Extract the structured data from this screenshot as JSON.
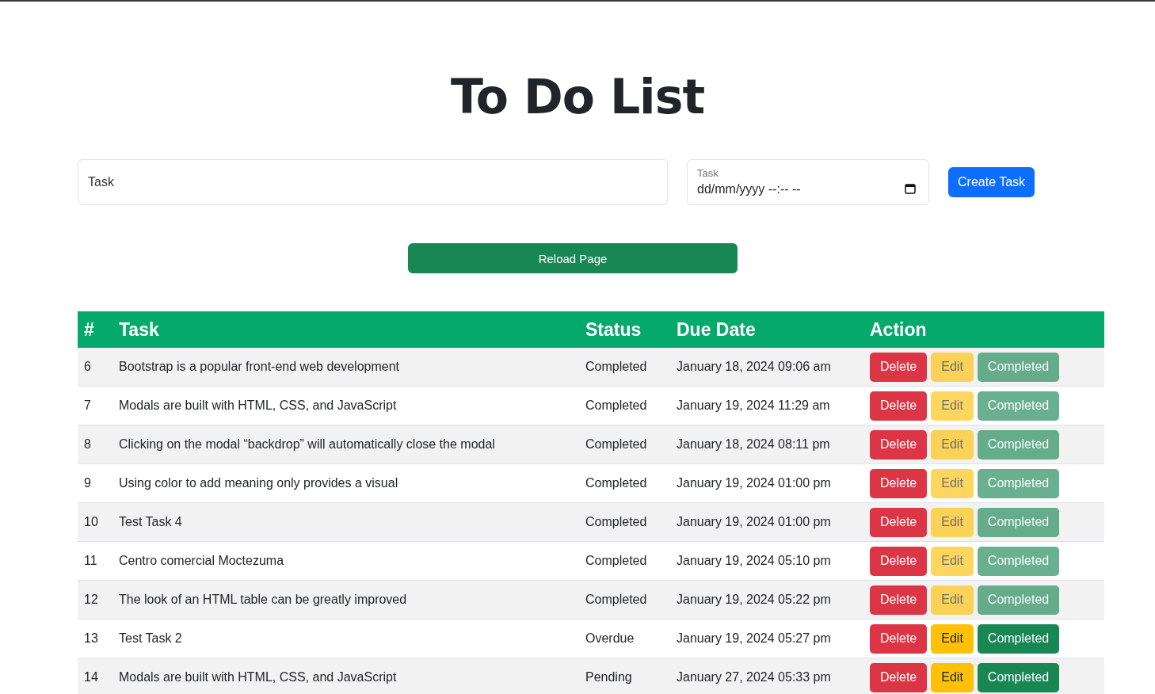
{
  "title": "To Do List",
  "form": {
    "task_field": {
      "placeholder": "Task"
    },
    "date_field": {
      "label": "Task",
      "value": "dd/mm/yyyy --:-- --"
    },
    "create_button": "Create Task"
  },
  "reload_button": "Reload Page",
  "table": {
    "columns": [
      "#",
      "Task",
      "Status",
      "Due Date",
      "Action"
    ],
    "rows": [
      {
        "id": "6",
        "task": "Bootstrap is a popular front-end web development",
        "status": "Completed",
        "due": "January 18, 2024 09:06 am",
        "delete": "Delete",
        "edit": {
          "label": "Edit",
          "disabled": true
        },
        "complete": {
          "label": "Completed",
          "disabled": true
        }
      },
      {
        "id": "7",
        "task": "Modals are built with HTML, CSS, and JavaScript",
        "status": "Completed",
        "due": "January 19, 2024 11:29 am",
        "delete": "Delete",
        "edit": {
          "label": "Edit",
          "disabled": true
        },
        "complete": {
          "label": "Completed",
          "disabled": true
        }
      },
      {
        "id": "8",
        "task": "Clicking on the modal “backdrop” will automatically close the modal",
        "status": "Completed",
        "due": "January 18, 2024 08:11 pm",
        "delete": "Delete",
        "edit": {
          "label": "Edit",
          "disabled": true
        },
        "complete": {
          "label": "Completed",
          "disabled": true
        }
      },
      {
        "id": "9",
        "task": "Using color to add meaning only provides a visual",
        "status": "Completed",
        "due": "January 19, 2024 01:00 pm",
        "delete": "Delete",
        "edit": {
          "label": "Edit",
          "disabled": true
        },
        "complete": {
          "label": "Completed",
          "disabled": true
        }
      },
      {
        "id": "10",
        "task": "Test Task 4",
        "status": "Completed",
        "due": "January 19, 2024 01:00 pm",
        "delete": "Delete",
        "edit": {
          "label": "Edit",
          "disabled": true
        },
        "complete": {
          "label": "Completed",
          "disabled": true
        }
      },
      {
        "id": "11",
        "task": "Centro comercial Moctezuma",
        "status": "Completed",
        "due": "January 19, 2024 05:10 pm",
        "delete": "Delete",
        "edit": {
          "label": "Edit",
          "disabled": true
        },
        "complete": {
          "label": "Completed",
          "disabled": true
        }
      },
      {
        "id": "12",
        "task": "The look of an HTML table can be greatly improved",
        "status": "Completed",
        "due": "January 19, 2024 05:22 pm",
        "delete": "Delete",
        "edit": {
          "label": "Edit",
          "disabled": true
        },
        "complete": {
          "label": "Completed",
          "disabled": true
        }
      },
      {
        "id": "13",
        "task": "Test Task 2",
        "status": "Overdue",
        "due": "January 19, 2024 05:27 pm",
        "delete": "Delete",
        "edit": {
          "label": "Edit",
          "disabled": false
        },
        "complete": {
          "label": "Completed",
          "disabled": false
        }
      },
      {
        "id": "14",
        "task": "Modals are built with HTML, CSS, and JavaScript",
        "status": "Pending",
        "due": "January 27, 2024 05:33 pm",
        "delete": "Delete",
        "edit": {
          "label": "Edit",
          "disabled": false
        },
        "complete": {
          "label": "Completed",
          "disabled": false
        }
      }
    ]
  }
}
